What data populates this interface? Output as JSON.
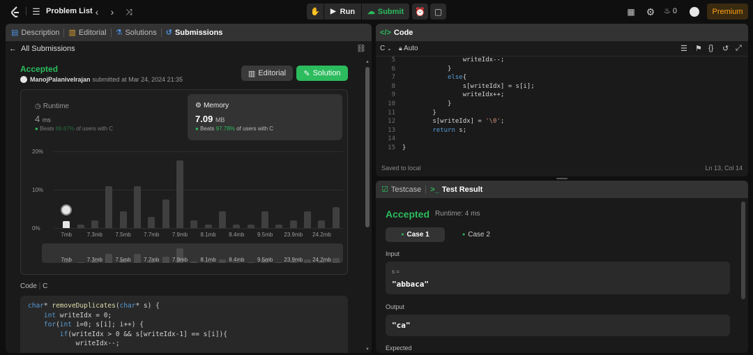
{
  "topbar": {
    "problem_list": "Problem List",
    "run": "Run",
    "submit": "Submit",
    "notif_count": "0",
    "premium": "Premium"
  },
  "left": {
    "tabs": [
      {
        "label": "Description"
      },
      {
        "label": "Editorial"
      },
      {
        "label": "Solutions"
      },
      {
        "label": "Submissions"
      }
    ],
    "back": "All Submissions",
    "status": "Accepted",
    "user": "ManojPalanivelrajan",
    "submitted": "submitted at Mar 24, 2024 21:35",
    "editorial_btn": "Editorial",
    "solution_btn": "Solution",
    "runtime": {
      "label": "Runtime",
      "value": "4",
      "unit": "ms",
      "beats": "Beats",
      "pct": "86.67%",
      "suffix": "of users with C"
    },
    "memory": {
      "label": "Memory",
      "value": "7.09",
      "unit": "MB",
      "beats": "Beats",
      "pct": "97.78%",
      "suffix": "of users with C"
    },
    "code_label": "Code",
    "code_lang": "C"
  },
  "chart_data": {
    "type": "bar",
    "yticks": [
      "20%",
      "10%",
      "0%"
    ],
    "ylim": [
      0,
      20
    ],
    "xticks": [
      "7mb",
      "7.3mb",
      "7.5mb",
      "7.7mb",
      "7.9mb",
      "8.1mb",
      "8.4mb",
      "9.5mb",
      "23.9mb",
      "24.2mb"
    ],
    "values": [
      1.8,
      1,
      2,
      11,
      4.3,
      11,
      3,
      7.5,
      17.7,
      2,
      1,
      4.3,
      1,
      1,
      4.3,
      1,
      2,
      4.3,
      2,
      5.5
    ],
    "highlight_index": 0,
    "overview_ticks": [
      "7mb",
      "7.3mb",
      "7.5mb",
      "7.7mb",
      "7.9mb",
      "8.1mb",
      "8.4mb",
      "9.5mb",
      "23.9mb",
      "24.2mb"
    ]
  },
  "left_code": [
    "char* removeDuplicates(char* s) {",
    "    int writeIdx = 0;",
    "    for(int i=0; s[i]; i++) {",
    "        if(writeIdx > 0 && s[writeIdx-1] == s[i]){",
    "            writeIdx--;"
  ],
  "right": {
    "code_tab": "Code",
    "lang": "C",
    "auto": "Auto",
    "lines": [
      {
        "n": "5",
        "t": "                writeIdx--;"
      },
      {
        "n": "6",
        "t": "            }"
      },
      {
        "n": "7",
        "t": "            else{"
      },
      {
        "n": "8",
        "t": "                s[writeIdx] = s[i];"
      },
      {
        "n": "9",
        "t": "                writeIdx++;"
      },
      {
        "n": "10",
        "t": "            }"
      },
      {
        "n": "11",
        "t": "        }"
      },
      {
        "n": "12",
        "t": "        s[writeIdx] = '\\0';"
      },
      {
        "n": "13",
        "t": "        return s;"
      },
      {
        "n": "14",
        "t": ""
      },
      {
        "n": "15",
        "t": "}"
      }
    ],
    "saved": "Saved to local",
    "cursor": "Ln 13, Col 14",
    "testcase_tab": "Testcase",
    "result_tab": "Test Result",
    "result_status": "Accepted",
    "result_runtime": "Runtime: 4 ms",
    "case1": "Case 1",
    "case2": "Case 2",
    "input_label": "Input",
    "input_var": "s =",
    "input_val": "\"abbaca\"",
    "output_label": "Output",
    "output_val": "\"ca\"",
    "expected_label": "Expected"
  }
}
